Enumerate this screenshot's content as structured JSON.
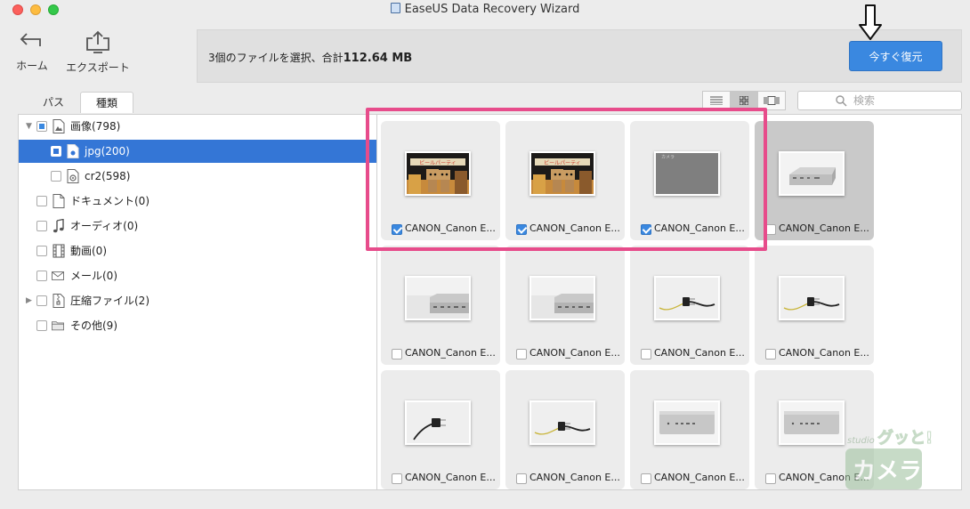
{
  "window": {
    "title": "EaseUS Data Recovery Wizard"
  },
  "toolbar": {
    "home_label": "ホーム",
    "export_label": "エクスポート"
  },
  "info": {
    "selection_text": "3個のファイルを選択、合計",
    "total_size": "112.64 MB",
    "recover_label": "今すぐ復元"
  },
  "tabs": {
    "path_label": "パス",
    "type_label": "種類"
  },
  "search": {
    "placeholder": "検索"
  },
  "tree": [
    {
      "label": "画像(798)",
      "icon": "image-icon",
      "expanded": true,
      "state": "partial"
    },
    {
      "label": "jpg(200)",
      "icon": "jpg-file-icon",
      "state": "partial",
      "selected": true
    },
    {
      "label": "cr2(598)",
      "icon": "cr2-file-icon",
      "state": "unchecked"
    },
    {
      "label": "ドキュメント(0)",
      "icon": "document-icon",
      "state": "unchecked"
    },
    {
      "label": "オーディオ(0)",
      "icon": "music-note-icon",
      "state": "unchecked"
    },
    {
      "label": "動画(0)",
      "icon": "film-icon",
      "state": "unchecked"
    },
    {
      "label": "メール(0)",
      "icon": "envelope-icon",
      "state": "unchecked"
    },
    {
      "label": "圧縮ファイル(2)",
      "icon": "archive-icon",
      "state": "unchecked",
      "expandable": true
    },
    {
      "label": "その他(9)",
      "icon": "folder-icon",
      "state": "unchecked"
    }
  ],
  "files": [
    {
      "name": "CANON_Canon E...",
      "checked": true,
      "thumb": "danbo"
    },
    {
      "name": "CANON_Canon E...",
      "checked": true,
      "thumb": "danbo"
    },
    {
      "name": "CANON_Canon E...",
      "checked": true,
      "thumb": "gray"
    },
    {
      "name": "CANON_Canon E...",
      "checked": false,
      "thumb": "minipc"
    },
    {
      "name": "CANON_Canon E...",
      "checked": false,
      "thumb": "minipc-side"
    },
    {
      "name": "CANON_Canon E...",
      "checked": false,
      "thumb": "minipc-side"
    },
    {
      "name": "CANON_Canon E...",
      "checked": false,
      "thumb": "cable"
    },
    {
      "name": "CANON_Canon E...",
      "checked": false,
      "thumb": "cable"
    },
    {
      "name": "CANON_Canon E...",
      "checked": false,
      "thumb": "cable-plug"
    },
    {
      "name": "CANON_Canon E...",
      "checked": false,
      "thumb": "cable"
    },
    {
      "name": "CANON_Canon E...",
      "checked": false,
      "thumb": "minipc-front"
    },
    {
      "name": "CANON_Canon E...",
      "checked": false,
      "thumb": "minipc-front"
    }
  ],
  "watermark": {
    "line1": "studio グッと!",
    "line2": "カメラ"
  },
  "colors": {
    "accent": "#3a88e0",
    "selection": "#3476d6",
    "highlight": "#e74c8b"
  }
}
